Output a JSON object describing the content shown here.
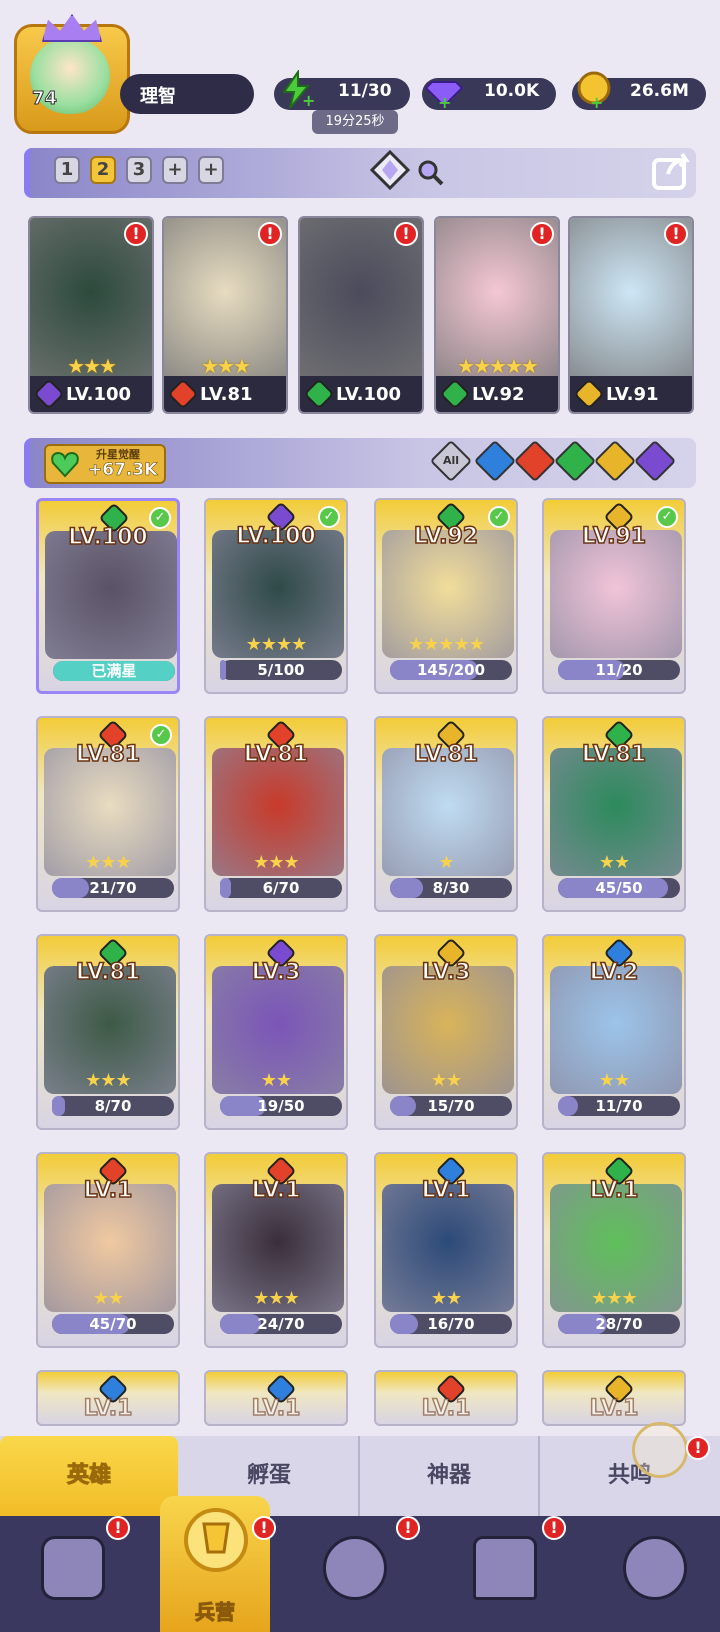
{
  "player": {
    "level": "74",
    "name": "理智"
  },
  "resources": [
    {
      "name": "energy",
      "icon": "lightning-icon",
      "value": "11/30",
      "color": "#4ccb3c"
    },
    {
      "name": "gems",
      "icon": "diamond-icon",
      "value": "10.0K",
      "color": "#8b5cf6"
    },
    {
      "name": "coins",
      "icon": "coin-icon",
      "value": "26.6M",
      "color": "#f4c430"
    }
  ],
  "energy_timer": "19分25秒",
  "team": {
    "slots": [
      "1",
      "2",
      "3",
      "+",
      "+"
    ],
    "active_slot": "2"
  },
  "lineup": [
    {
      "level": "LV.100",
      "element": "dark",
      "color": "#7a4bd1",
      "stars": "★★★"
    },
    {
      "level": "LV.81",
      "element": "fire",
      "color": "#e2412a",
      "stars": "★★★"
    },
    {
      "level": "LV.100",
      "element": "nature",
      "color": "#2fb24a",
      "stars": ""
    },
    {
      "level": "LV.92",
      "element": "nature",
      "color": "#2fb24a",
      "stars": "★★★★★"
    },
    {
      "level": "LV.91",
      "element": "light",
      "color": "#e8b52a",
      "stars": ""
    }
  ],
  "awaken": {
    "title": "升星觉醒",
    "value": "+67.3K"
  },
  "filters": [
    {
      "name": "All",
      "label": "All",
      "color": "#c9c7d6"
    },
    {
      "name": "water",
      "label": "",
      "color": "#2f7fdc"
    },
    {
      "name": "fire",
      "label": "",
      "color": "#e2412a"
    },
    {
      "name": "nature",
      "label": "",
      "color": "#2fb24a"
    },
    {
      "name": "light",
      "label": "",
      "color": "#e8b52a"
    },
    {
      "name": "dark",
      "label": "",
      "color": "#7a4bd1"
    }
  ],
  "heroes": [
    {
      "level": "LV.100",
      "progress": "已满星",
      "fill": 1.0,
      "element": "#2fb24a",
      "checked": true,
      "stars": ""
    },
    {
      "level": "LV.100",
      "progress": "5/100",
      "fill": 0.05,
      "element": "#7a4bd1",
      "checked": true,
      "stars": "★★★★"
    },
    {
      "level": "LV.92",
      "progress": "145/200",
      "fill": 0.72,
      "element": "#2fb24a",
      "checked": true,
      "stars": "★★★★★"
    },
    {
      "level": "LV.91",
      "progress": "11/20",
      "fill": 0.55,
      "element": "#e8b52a",
      "checked": true,
      "stars": ""
    },
    {
      "level": "LV.81",
      "progress": "21/70",
      "fill": 0.3,
      "element": "#e2412a",
      "checked": true,
      "stars": "★★★"
    },
    {
      "level": "LV.81",
      "progress": "6/70",
      "fill": 0.09,
      "element": "#e2412a",
      "checked": false,
      "stars": "★★★"
    },
    {
      "level": "LV.81",
      "progress": "8/30",
      "fill": 0.27,
      "element": "#e8b52a",
      "checked": false,
      "stars": "★"
    },
    {
      "level": "LV.81",
      "progress": "45/50",
      "fill": 0.9,
      "element": "#2fb24a",
      "checked": false,
      "stars": "★★"
    },
    {
      "level": "LV.81",
      "progress": "8/70",
      "fill": 0.11,
      "element": "#2fb24a",
      "checked": false,
      "stars": "★★★"
    },
    {
      "level": "LV.3",
      "progress": "19/50",
      "fill": 0.38,
      "element": "#7a4bd1",
      "checked": false,
      "stars": "★★"
    },
    {
      "level": "LV.3",
      "progress": "15/70",
      "fill": 0.21,
      "element": "#e8b52a",
      "checked": false,
      "stars": "★★"
    },
    {
      "level": "LV.2",
      "progress": "11/70",
      "fill": 0.16,
      "element": "#2f7fdc",
      "checked": false,
      "stars": "★★"
    },
    {
      "level": "LV.1",
      "progress": "45/70",
      "fill": 0.64,
      "element": "#e2412a",
      "checked": false,
      "stars": "★★"
    },
    {
      "level": "LV.1",
      "progress": "24/70",
      "fill": 0.34,
      "element": "#e2412a",
      "checked": false,
      "stars": "★★★"
    },
    {
      "level": "LV.1",
      "progress": "16/70",
      "fill": 0.23,
      "element": "#2f7fdc",
      "checked": false,
      "stars": "★★"
    },
    {
      "level": "LV.1",
      "progress": "28/70",
      "fill": 0.4,
      "element": "#2fb24a",
      "checked": false,
      "stars": "★★★"
    }
  ],
  "partial_row": [
    {
      "level": "LV.1",
      "element": "#2f7fdc"
    },
    {
      "level": "LV.1",
      "element": "#2f7fdc"
    },
    {
      "level": "LV.1",
      "element": "#e2412a"
    },
    {
      "level": "LV.1",
      "element": "#e8b52a"
    }
  ],
  "tabs": [
    "英雄",
    "孵蛋",
    "神器",
    "共鸣"
  ],
  "active_tab": "英雄",
  "nav": {
    "active_label": "兵营"
  }
}
